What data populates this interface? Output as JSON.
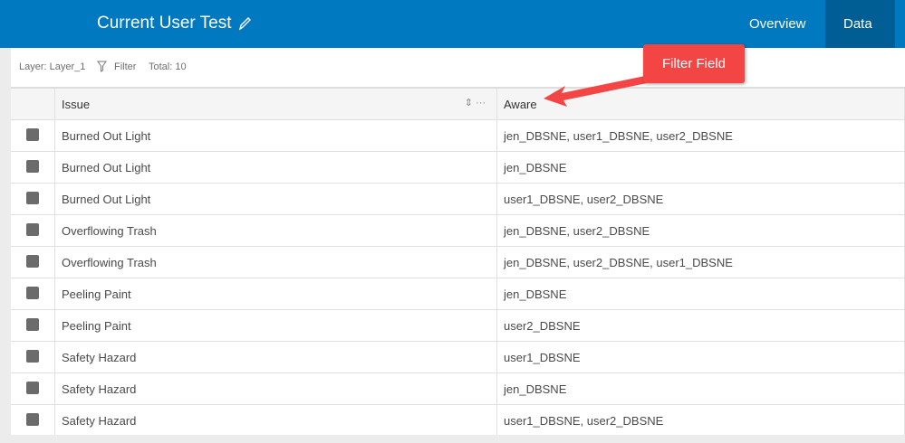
{
  "header": {
    "title": "Current User Test",
    "tabs": [
      {
        "label": "Overview"
      },
      {
        "label": "Data"
      }
    ]
  },
  "toolbar": {
    "layer": "Layer: Layer_1",
    "filter": "Filter",
    "total": "Total: 10"
  },
  "table": {
    "columns": [
      "Issue",
      "Aware"
    ],
    "rows": [
      [
        "Burned Out Light",
        "jen_DBSNE, user1_DBSNE, user2_DBSNE"
      ],
      [
        "Burned Out Light",
        "jen_DBSNE"
      ],
      [
        "Burned Out Light",
        "user1_DBSNE, user2_DBSNE"
      ],
      [
        "Overflowing Trash",
        "jen_DBSNE, user2_DBSNE"
      ],
      [
        "Overflowing Trash",
        "jen_DBSNE, user2_DBSNE, user1_DBSNE"
      ],
      [
        "Peeling Paint",
        "jen_DBSNE"
      ],
      [
        "Peeling Paint",
        "user2_DBSNE"
      ],
      [
        "Safety Hazard",
        "user1_DBSNE"
      ],
      [
        "Safety Hazard",
        "jen_DBSNE"
      ],
      [
        "Safety Hazard",
        "user1_DBSNE, user2_DBSNE"
      ]
    ]
  },
  "annotation": {
    "label": "Filter Field",
    "color": "#f44545"
  }
}
